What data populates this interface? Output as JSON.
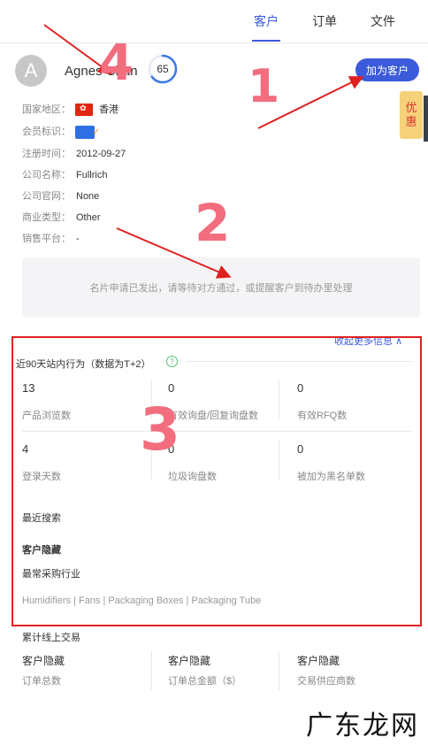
{
  "tabs": [
    {
      "label": "客户"
    },
    {
      "label": "订单"
    },
    {
      "label": "文件"
    }
  ],
  "customer": {
    "avatar_letter": "A",
    "name": "Agnes Chan",
    "score": "65",
    "score_fraction": 0.65
  },
  "add_button": "加为客户",
  "promo": {
    "line1": "优",
    "line2": "惠"
  },
  "info": {
    "region_label": "国家地区：",
    "region_value": "香港",
    "member_label": "会员标识：",
    "reg_label": "注册时间：",
    "reg_value": "2012-09-27",
    "company_label": "公司名称：",
    "company_value": "Fullrich",
    "website_label": "公司官网：",
    "website_value": "None",
    "biztype_label": "商业类型：",
    "biztype_value": "Other",
    "platform_label": "销售平台：",
    "platform_value": "-"
  },
  "notice": "名片申请已发出，请等待对方通过，或提醒客户到待办里处理",
  "collapse": "收起更多信息 ∧",
  "behavior": {
    "title": "近90天站内行为（数据为T+2）",
    "help": "?",
    "stats": [
      {
        "value": "13",
        "label": "产品浏览数"
      },
      {
        "value": "0",
        "label": "有效询盘/回复询盘数"
      },
      {
        "value": "0",
        "label": "有效RFQ数"
      },
      {
        "value": "4",
        "label": "登录天数"
      },
      {
        "value": "0",
        "label": "垃圾询盘数"
      },
      {
        "value": "0",
        "label": "被加为黑名单数"
      }
    ],
    "recent_search": "最近搜索",
    "hidden": "客户隐藏",
    "industry_label": "最常采购行业",
    "industries": "Humidifiers | Fans | Packaging Boxes | Packaging Tube"
  },
  "trade": {
    "title": "累计线上交易",
    "items": [
      {
        "value": "客户隐藏",
        "label": "订单总数"
      },
      {
        "value": "客户隐藏",
        "label": "订单总金额（$）"
      },
      {
        "value": "客户隐藏",
        "label": "交易供应商数"
      }
    ]
  },
  "annotations": {
    "n1": "1",
    "n2": "2",
    "n3": "3",
    "n4": "4",
    "color": "#f26d7d",
    "arrow_color": "#e02020"
  },
  "watermark": "广东龙网"
}
